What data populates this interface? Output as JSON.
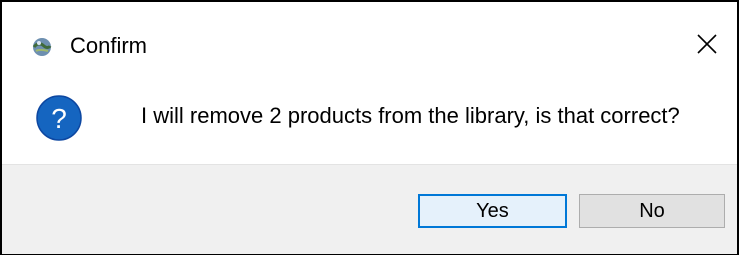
{
  "window": {
    "title": "Confirm",
    "app_icon": "globe-app-icon",
    "close_icon": "close-icon"
  },
  "message": {
    "icon": "question-icon",
    "text": "I will remove 2 products from the library, is that correct?"
  },
  "buttons": {
    "yes_label": "Yes",
    "no_label": "No",
    "default": "Yes"
  },
  "colors": {
    "question_icon_bg": "#1565c0",
    "default_button_border": "#0078d7",
    "default_button_bg": "#e5f1fb",
    "button_bg": "#e1e1e1",
    "footer_bg": "#f0f0f0"
  }
}
